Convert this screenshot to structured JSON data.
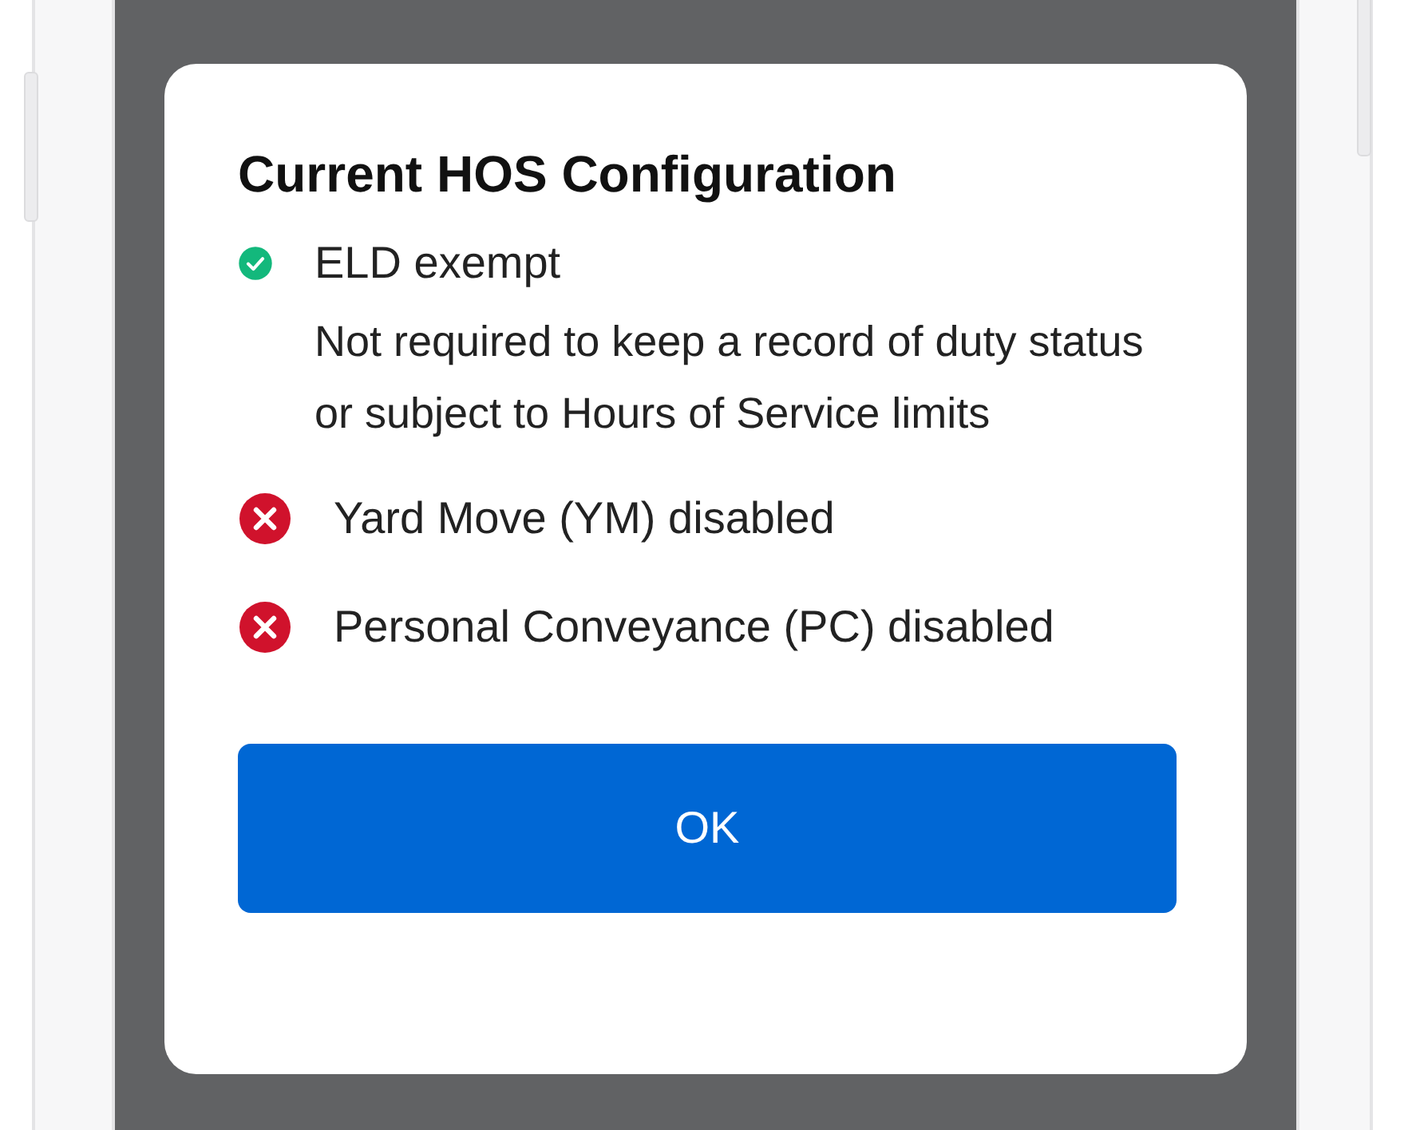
{
  "dialog": {
    "title": "Current HOS Configuration",
    "items": [
      {
        "kind": "success",
        "label": "ELD exempt",
        "description": "Not required to keep a record of duty status or subject to Hours of Service limits"
      },
      {
        "kind": "error",
        "label": "Yard Move (YM) disabled"
      },
      {
        "kind": "error",
        "label": "Personal Conveyance (PC) disabled"
      }
    ],
    "button": "OK"
  }
}
